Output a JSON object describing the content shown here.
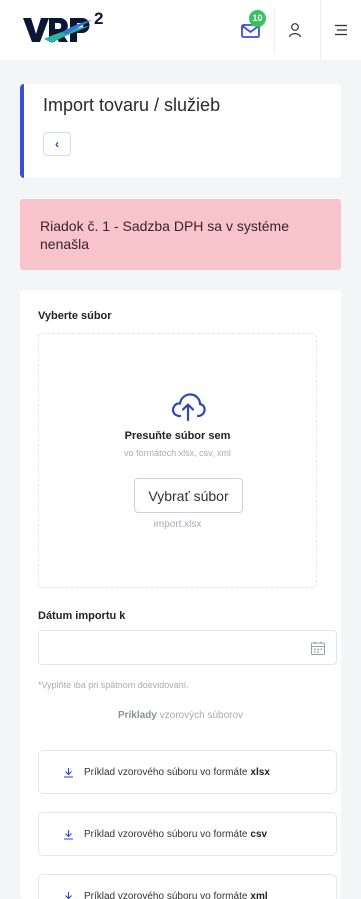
{
  "header": {
    "logo_text": "VRP",
    "logo_superscript": "2",
    "mail_badge": "10",
    "icons": [
      "mail-icon",
      "user-icon",
      "menu-icon"
    ]
  },
  "page": {
    "title": "Import tovaru / služieb",
    "back_label": "‹"
  },
  "alert": {
    "message": "Riadok č. 1 - Sadzba DPH sa v systéme nenašla",
    "color": "#f8c4cb"
  },
  "form": {
    "file_label": "Vyberte súbor",
    "dropzone_title": "Presuňte súbor sem",
    "dropzone_formats": "vo formátoch xlsx, csv, xml",
    "choose_button": "Vybrať súbor",
    "selected_file": "import.xlsx",
    "date_label": "Dátum importu k",
    "date_value": "",
    "date_hint": "*Vyplňte iba pri spätnom doevidovaní.",
    "examples_bold": "Príklady",
    "examples_rest": "vzorových súborov",
    "downloads": [
      {
        "label": "Príklad vzorového súboru vo formáte",
        "format": "xlsx"
      },
      {
        "label": "Príklad vzorového súboru vo formáte",
        "format": "csv"
      },
      {
        "label": "Príklad vzorového súboru vo formáte",
        "format": "xml"
      }
    ]
  },
  "colors": {
    "accent": "#3a4fd6",
    "badge": "#35c25f",
    "alert_bg": "#f8c4cb"
  }
}
